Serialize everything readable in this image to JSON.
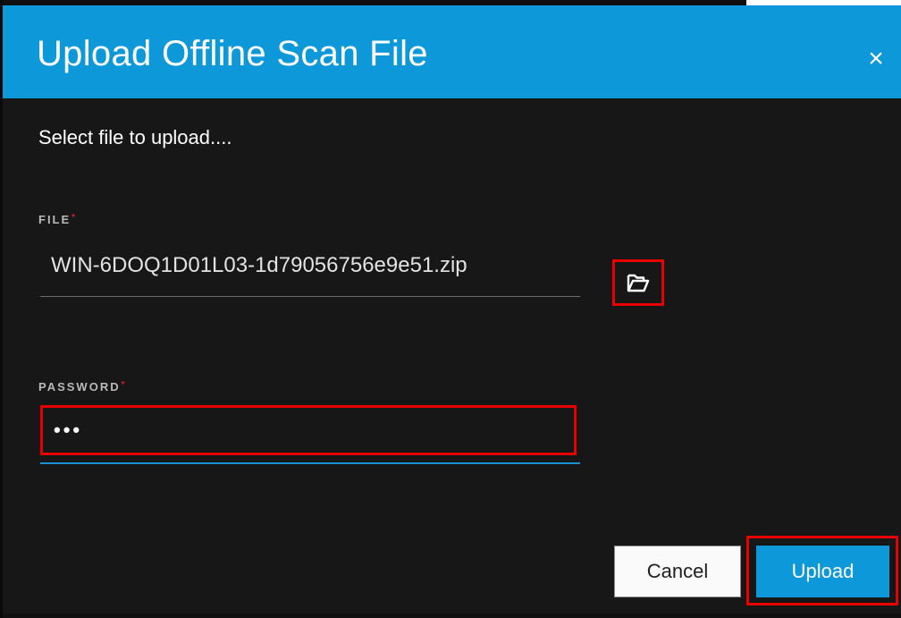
{
  "dialog": {
    "title": "Upload Offline Scan File",
    "close_glyph": "×",
    "close_icon": "close-icon",
    "prompt": "Select file to upload....",
    "colors": {
      "header": "#0d98d9",
      "body": "#171717",
      "required": "#d21f2b",
      "highlight": "#ea0000",
      "focus_underline": "#1c8fd0"
    }
  },
  "file_field": {
    "label": "FILE",
    "required_mark": "*",
    "value": "WIN-6DOQ1D01L03-1d79056756e9e51.zip",
    "browse_icon": "folder-open-icon"
  },
  "password_field": {
    "label": "PASSWORD",
    "required_mark": "*",
    "masked_value": "•••"
  },
  "buttons": {
    "cancel_label": "Cancel",
    "upload_label": "Upload"
  }
}
